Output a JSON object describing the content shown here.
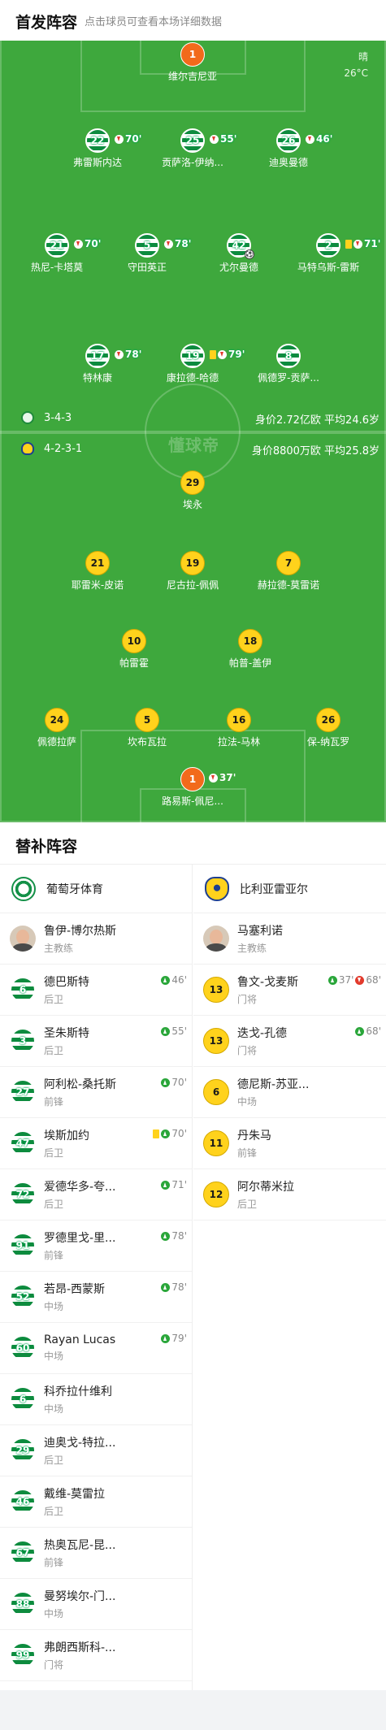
{
  "header": {
    "title": "首发阵容",
    "hint": "点击球员可查看本场详细数据"
  },
  "weather": {
    "condition": "晴",
    "temperature": "26°C"
  },
  "watermark": "懂球帝",
  "home": {
    "formation": "3-4-3",
    "value": "身价2.72亿欧",
    "avg_age": "平均24.6岁",
    "players": [
      {
        "num": "1",
        "name": "维尔吉尼亚",
        "gk": true
      },
      {
        "num": "22",
        "name": "弗雷斯内达",
        "out": "70'"
      },
      {
        "num": "25",
        "name": "贡萨洛-伊纳...",
        "out": "55'"
      },
      {
        "num": "26",
        "name": "迪奥曼德",
        "out": "46'"
      },
      {
        "num": "21",
        "name": "热尼-卡塔莫",
        "out": "70'"
      },
      {
        "num": "5",
        "name": "守田英正",
        "out": "78'"
      },
      {
        "num": "42",
        "name": "尤尔曼德",
        "goal": "⚽"
      },
      {
        "num": "2",
        "name": "马特乌斯-雷斯",
        "yellow": true,
        "out": "71'"
      },
      {
        "num": "17",
        "name": "特林康",
        "out": "78'"
      },
      {
        "num": "19",
        "name": "康拉德-哈德",
        "yellow": true,
        "out": "79'"
      },
      {
        "num": "8",
        "name": "佩德罗-贡萨..."
      }
    ]
  },
  "away": {
    "formation": "4-2-3-1",
    "value": "身价8800万欧",
    "avg_age": "平均25.8岁",
    "players": [
      {
        "num": "29",
        "name": "埃永"
      },
      {
        "num": "21",
        "name": "耶雷米-皮诺"
      },
      {
        "num": "19",
        "name": "尼古拉-佩佩"
      },
      {
        "num": "7",
        "name": "赫拉德-莫雷诺"
      },
      {
        "num": "10",
        "name": "帕雷霍"
      },
      {
        "num": "18",
        "name": "帕普-盖伊"
      },
      {
        "num": "24",
        "name": "佩德拉萨"
      },
      {
        "num": "5",
        "name": "坎布瓦拉"
      },
      {
        "num": "16",
        "name": "拉法-马林"
      },
      {
        "num": "26",
        "name": "保-纳瓦罗"
      },
      {
        "num": "1",
        "name": "路易斯-佩尼...",
        "gk": true,
        "out": "37'"
      }
    ]
  },
  "subs_title": "替补阵容",
  "subs_left": {
    "team": "葡萄牙体育",
    "coach": {
      "name": "鲁伊-博尔热斯",
      "role": "主教练"
    },
    "players": [
      {
        "num": "6",
        "name": "德巴斯特",
        "pos": "后卫",
        "in": "46'"
      },
      {
        "num": "3",
        "name": "圣朱斯特",
        "pos": "后卫",
        "in": "55'"
      },
      {
        "num": "27",
        "name": "阿利松-桑托斯",
        "pos": "前锋",
        "in": "70'"
      },
      {
        "num": "47",
        "name": "埃斯加约",
        "pos": "后卫",
        "yellow": true,
        "in": "70'"
      },
      {
        "num": "72",
        "name": "爱德华多-夸...",
        "pos": "后卫",
        "in": "71'"
      },
      {
        "num": "91",
        "name": "罗德里戈-里...",
        "pos": "前锋",
        "in": "78'"
      },
      {
        "num": "52",
        "name": "若昂-西蒙斯",
        "pos": "中场",
        "in": "78'"
      },
      {
        "num": "60",
        "name": "Rayan Lucas",
        "pos": "中场",
        "in": "79'"
      },
      {
        "num": "6",
        "name": "科乔拉什维利",
        "pos": "中场"
      },
      {
        "num": "29",
        "name": "迪奥戈-特拉...",
        "pos": "后卫"
      },
      {
        "num": "46",
        "name": "戴维-莫雷拉",
        "pos": "后卫"
      },
      {
        "num": "67",
        "name": "热奥瓦尼-昆...",
        "pos": "前锋"
      },
      {
        "num": "88",
        "name": "曼努埃尔-门...",
        "pos": "中场"
      },
      {
        "num": "99",
        "name": "弗朗西斯科-...",
        "pos": "门将"
      }
    ]
  },
  "subs_right": {
    "team": "比利亚雷亚尔",
    "coach": {
      "name": "马塞利诺",
      "role": "主教练"
    },
    "players": [
      {
        "num": "13",
        "name": "鲁文-戈麦斯",
        "pos": "门将",
        "in": "37'",
        "out": "68'"
      },
      {
        "num": "13",
        "name": "迭戈-孔德",
        "pos": "门将",
        "in": "68'"
      },
      {
        "num": "6",
        "name": "德尼斯-苏亚...",
        "pos": "中场"
      },
      {
        "num": "11",
        "name": "丹朱马",
        "pos": "前锋"
      },
      {
        "num": "12",
        "name": "阿尔蒂米拉",
        "pos": "后卫"
      }
    ]
  },
  "colors": {
    "pitch": "#3ea83d",
    "sporting": "#0d8b3e",
    "villarreal": "#ffd21c",
    "goalkeeper": "#f26a1b"
  }
}
